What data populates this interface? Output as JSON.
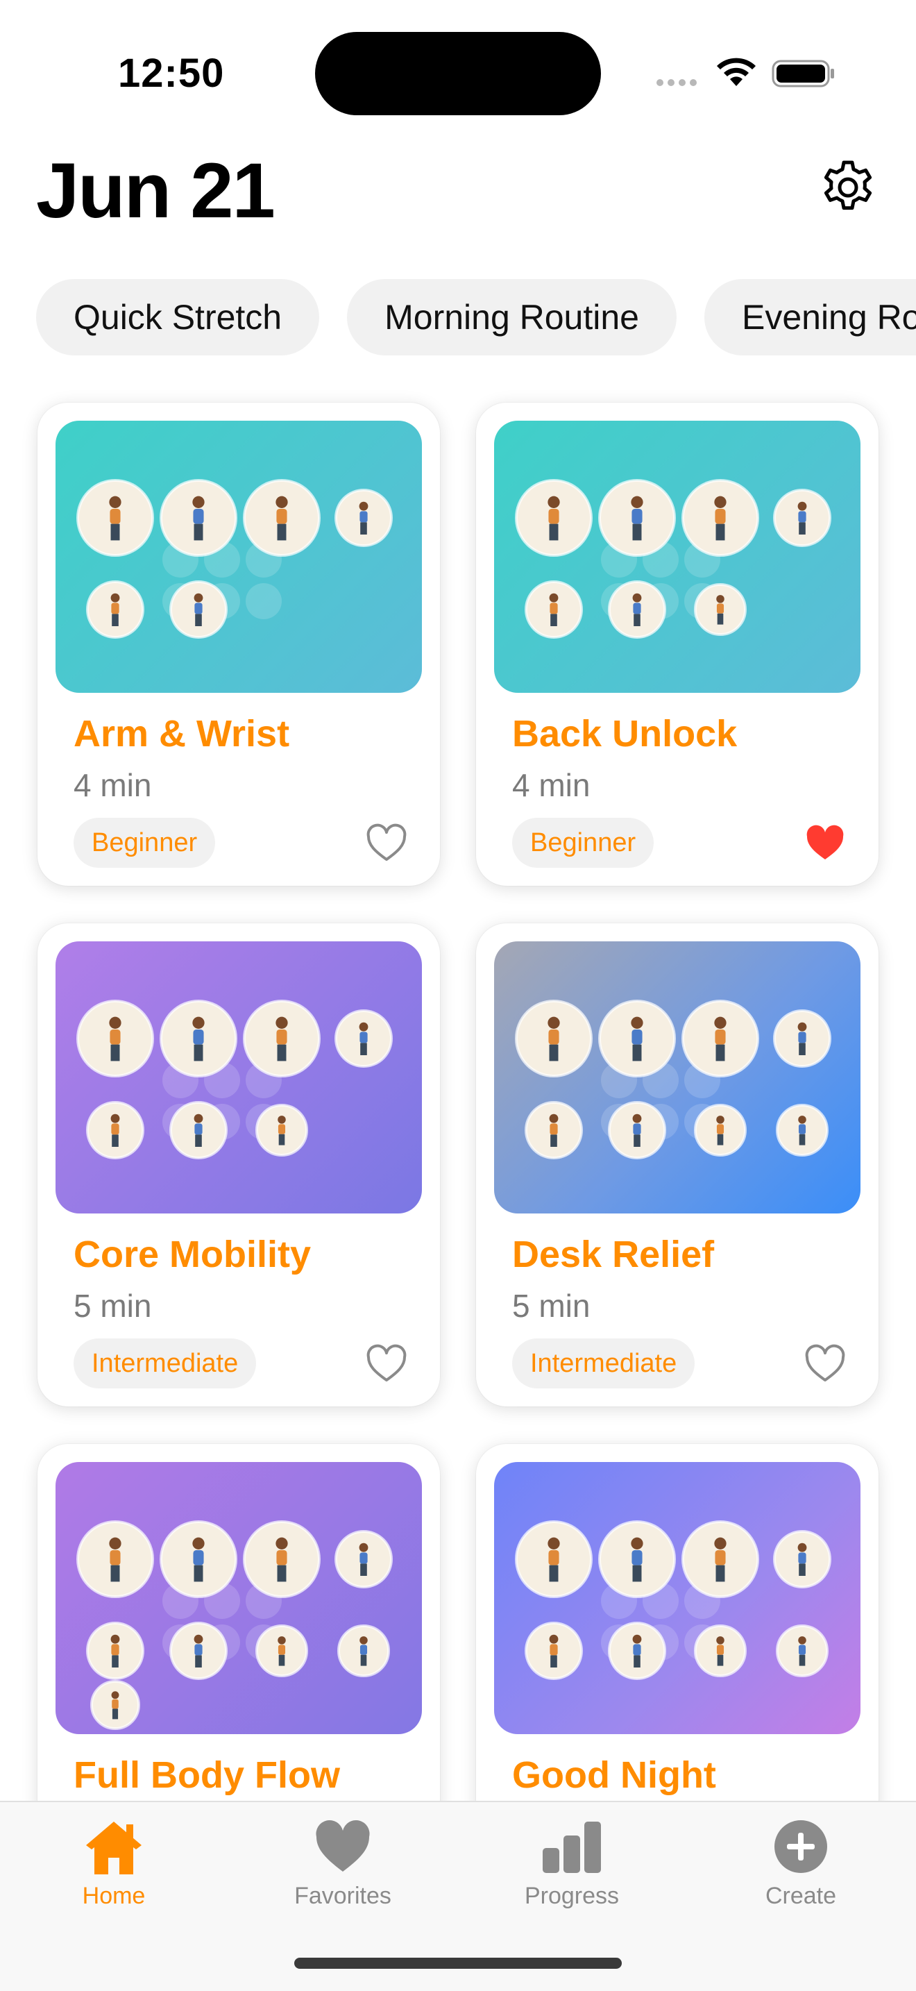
{
  "status_bar": {
    "time": "12:50"
  },
  "header": {
    "title": "Jun 21",
    "settings_icon": "gear-icon"
  },
  "chips": [
    "Quick Stretch",
    "Morning Routine",
    "Evening Routine"
  ],
  "routines": [
    {
      "title": "Arm & Wrist",
      "duration": "4 min",
      "level": "Beginner",
      "favorite": false,
      "poses": 6,
      "hero_colors": [
        "#3fd0c8",
        "#5cbcd8"
      ]
    },
    {
      "title": "Back Unlock",
      "duration": "4 min",
      "level": "Beginner",
      "favorite": true,
      "poses": 7,
      "hero_colors": [
        "#3fd0c8",
        "#5cbcd8"
      ]
    },
    {
      "title": "Core Mobility",
      "duration": "5 min",
      "level": "Intermediate",
      "favorite": false,
      "poses": 7,
      "hero_colors": [
        "#b07ee8",
        "#7b78e4"
      ]
    },
    {
      "title": "Desk Relief",
      "duration": "5 min",
      "level": "Intermediate",
      "favorite": false,
      "poses": 8,
      "hero_colors": [
        "#a4a7b4",
        "#3b8ef8"
      ]
    },
    {
      "title": "Full Body Flow",
      "poses": 9,
      "hero_colors": [
        "#b07ae6",
        "#8478e4"
      ]
    },
    {
      "title": "Good Night",
      "poses": 8,
      "hero_colors": [
        "#6f84f8",
        "#c37ee6"
      ]
    }
  ],
  "tabbar": {
    "items": [
      {
        "label": "Home",
        "icon": "house-icon",
        "active": true
      },
      {
        "label": "Favorites",
        "icon": "heart-icon",
        "active": false
      },
      {
        "label": "Progress",
        "icon": "bar-chart-icon",
        "active": false
      },
      {
        "label": "Create",
        "icon": "plus-circle-icon",
        "active": false
      }
    ]
  },
  "colors": {
    "accent": "#ff8c00",
    "favorite": "#ff3b30",
    "muted": "#8a8a8a"
  }
}
